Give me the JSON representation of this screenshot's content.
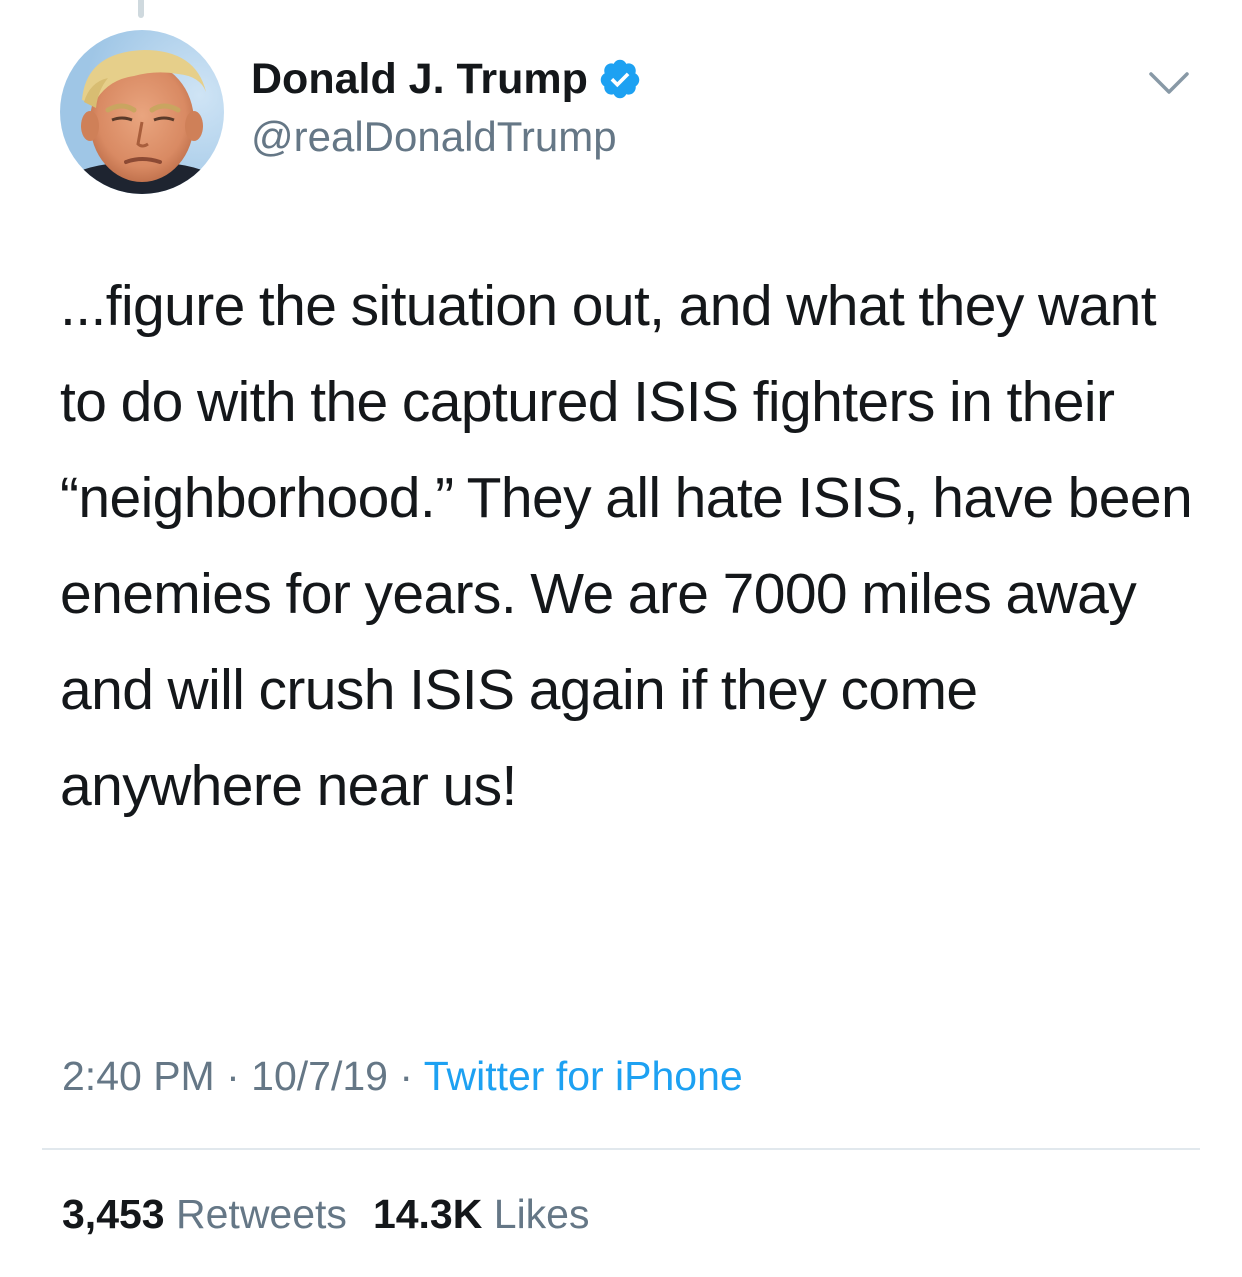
{
  "author": {
    "display_name": "Donald J. Trump",
    "handle": "@realDonaldTrump",
    "verified": true,
    "avatar_icon": "profile-photo",
    "verified_icon": "verified-badge-icon"
  },
  "tweet": {
    "text": "...figure the situation out, and what they want to do with the captured ISIS fighters in their “neighborhood.” They all hate ISIS, have been enemies for years. We are 7000 miles away and will crush ISIS again if they come anywhere near us!"
  },
  "meta": {
    "time": "2:40 PM",
    "separator": "·",
    "date": "10/7/19",
    "source": "Twitter for iPhone"
  },
  "stats": {
    "retweets_count": "3,453",
    "retweets_label": "Retweets",
    "likes_count": "14.3K",
    "likes_label": "Likes"
  },
  "colors": {
    "text_primary": "#14171a",
    "text_secondary": "#657786",
    "accent": "#1da1f2",
    "divider": "#e1e8ed"
  },
  "icons": {
    "more_options": "chevron-down-icon"
  }
}
